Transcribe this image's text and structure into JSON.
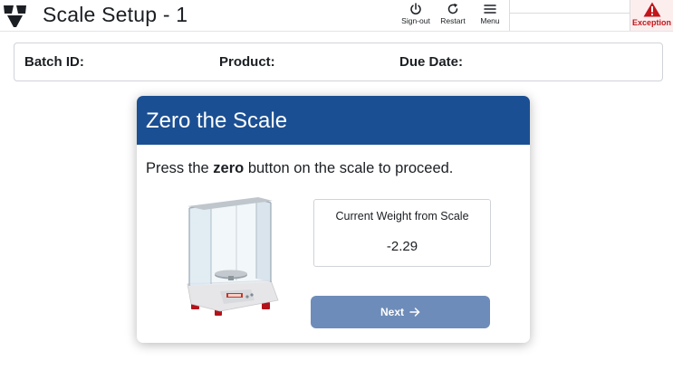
{
  "header": {
    "title": "Scale Setup - 1",
    "buttons": [
      {
        "label": "Sign-out",
        "icon": "power-icon"
      },
      {
        "label": "Restart",
        "icon": "restart-icon"
      },
      {
        "label": "Menu",
        "icon": "hamburger-icon"
      }
    ],
    "exception": {
      "label": "Exception",
      "icon": "warning-icon",
      "color": "#c2161b"
    }
  },
  "info": {
    "batch_label": "Batch ID:",
    "batch_value": "",
    "product_label": "Product:",
    "product_value": "",
    "due_label": "Due Date:",
    "due_value": ""
  },
  "panel": {
    "title": "Zero the Scale",
    "instruction_prefix": "Press the ",
    "instruction_bold": "zero",
    "instruction_suffix": " button on the scale to proceed.",
    "weight_label": "Current Weight from Scale",
    "weight_value": "-2.29",
    "next_label": "Next",
    "image_icon": "analytical-balance-image"
  },
  "colors": {
    "header_blue": "#1b4f93",
    "button_blue": "#6e8cb9",
    "exception_red": "#c2161b"
  }
}
